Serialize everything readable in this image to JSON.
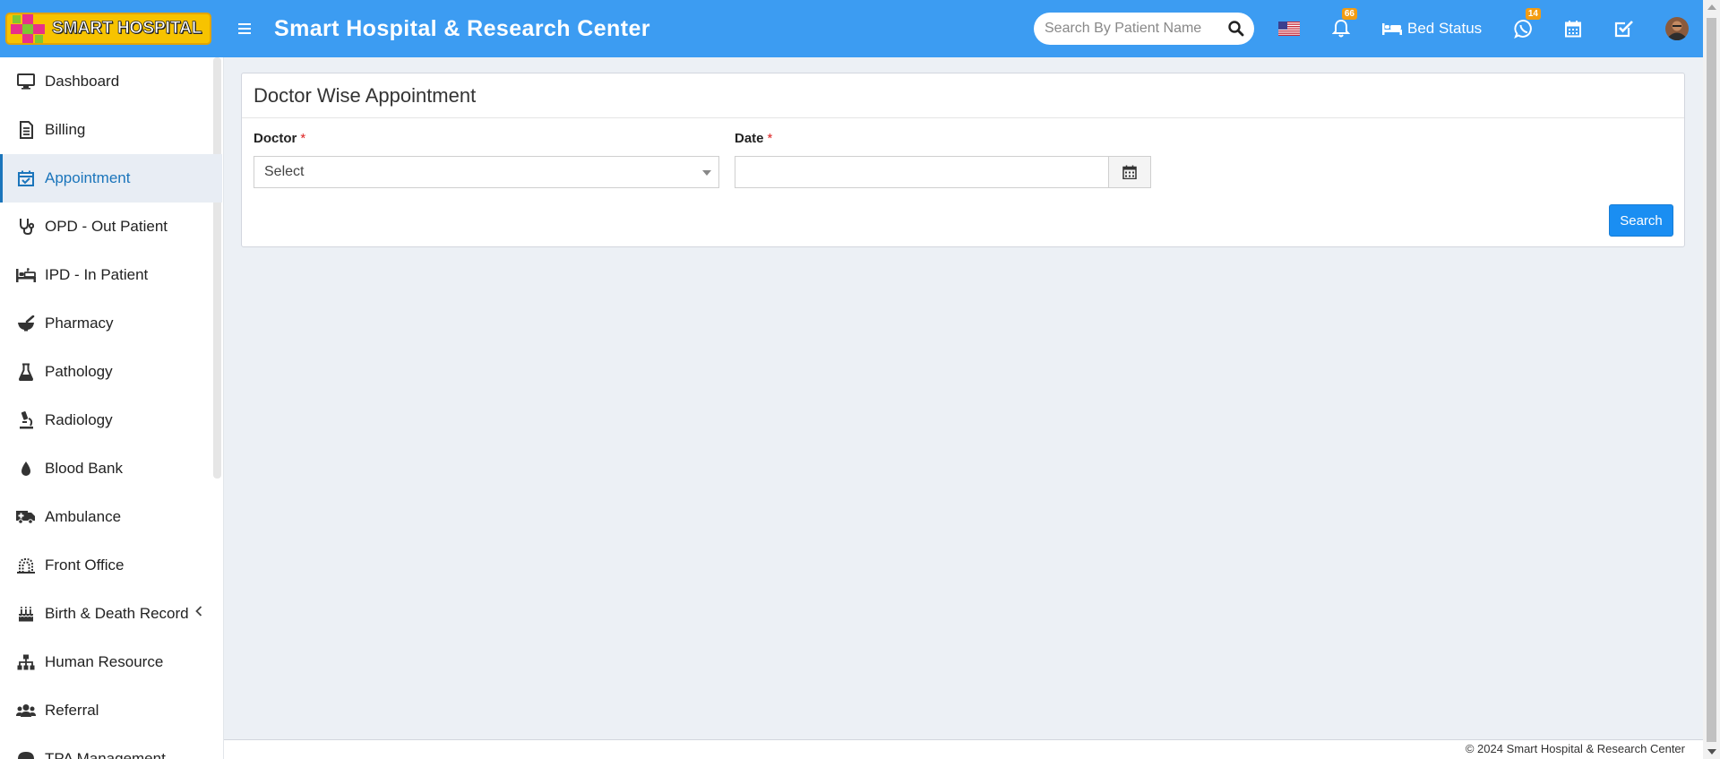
{
  "header": {
    "logo_text": "SMART HOSPITAL",
    "title": "Smart Hospital & Research Center",
    "search_placeholder": "Search By Patient Name",
    "notification_count": "66",
    "bed_status_label": "Bed Status",
    "whatsapp_count": "14",
    "accent_color": "#3c9cf2",
    "icons": [
      "menu-icon",
      "search-icon",
      "us-flag-icon",
      "bell-icon",
      "bed-icon",
      "whatsapp-icon",
      "calendar-icon",
      "task-check-icon",
      "user-avatar"
    ]
  },
  "sidebar": {
    "items": [
      {
        "label": "Dashboard",
        "icon": "monitor-icon"
      },
      {
        "label": "Billing",
        "icon": "billing-icon"
      },
      {
        "label": "Appointment",
        "icon": "calendar-check-icon",
        "active": true
      },
      {
        "label": "OPD - Out Patient",
        "icon": "stethoscope-icon"
      },
      {
        "label": "IPD - In Patient",
        "icon": "hospital-bed-icon"
      },
      {
        "label": "Pharmacy",
        "icon": "mortar-pestle-icon"
      },
      {
        "label": "Pathology",
        "icon": "flask-icon"
      },
      {
        "label": "Radiology",
        "icon": "microscope-icon"
      },
      {
        "label": "Blood Bank",
        "icon": "blood-drop-icon"
      },
      {
        "label": "Ambulance",
        "icon": "ambulance-icon"
      },
      {
        "label": "Front Office",
        "icon": "front-office-icon"
      },
      {
        "label": "Birth & Death Record",
        "icon": "birthday-cake-icon",
        "has_children": true
      },
      {
        "label": "Human Resource",
        "icon": "sitemap-icon"
      },
      {
        "label": "Referral",
        "icon": "users-icon"
      },
      {
        "label": "TPA Management",
        "icon": "umbrella-icon"
      }
    ]
  },
  "main": {
    "box_title": "Doctor Wise Appointment",
    "doctor_label": "Doctor",
    "doctor_value": "Select",
    "date_label": "Date",
    "date_value": "",
    "required_mark": "*",
    "search_button": "Search"
  },
  "footer": {
    "copyright": "© 2024 Smart Hospital & Research Center"
  }
}
